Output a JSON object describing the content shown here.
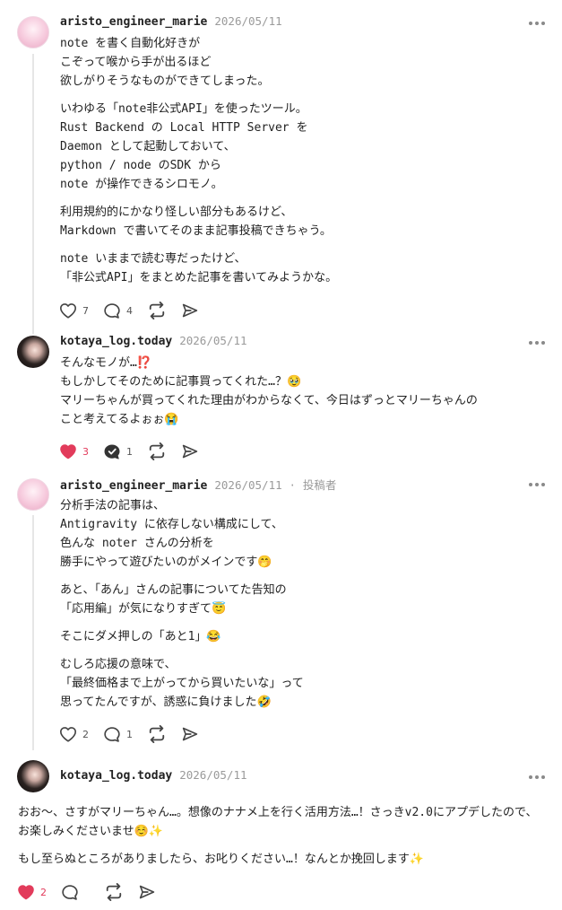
{
  "comments": [
    {
      "username": "aristo_engineer_marie",
      "date": "2026/05/11",
      "role": "",
      "paragraphs": [
        [
          "note を書く自動化好きが",
          "こぞって喉から手が出るほど",
          "欲しがりそうなものができてしまった。"
        ],
        [
          "いわゆる「note非公式API」を使ったツール。",
          "Rust Backend の Local HTTP Server を",
          "Daemon として起動しておいて、",
          "python / node のSDK から",
          "note が操作できるシロモノ。"
        ],
        [
          "利用規約的にかなり怪しい部分もあるけど、",
          "Markdown で書いてそのまま記事投稿できちゃう。"
        ],
        [
          "note いままで読む専だったけど、",
          "「非公式API」をまとめた記事を書いてみようかな。"
        ]
      ],
      "likes": "7",
      "liked": false,
      "replies": "4"
    },
    {
      "username": "kotaya_log.today",
      "date": "2026/05/11",
      "role": "",
      "paragraphs": [
        [
          "そんなモノが…⁉️",
          "もしかしてそのために記事買ってくれた…？🥹",
          "マリーちゃんが買ってくれた理由がわからなくて、今日はずっとマリーちゃんの",
          "こと考えてるよぉぉ😭"
        ]
      ],
      "likes": "3",
      "liked": true,
      "replies": "1"
    },
    {
      "username": "aristo_engineer_marie",
      "date": "2026/05/11",
      "role": "投稿者",
      "paragraphs": [
        [
          "分析手法の記事は、",
          "Antigravity に依存しない構成にして、",
          "色んな noter さんの分析を",
          "勝手にやって遊びたいのがメインです🤭"
        ],
        [
          "あと、「あん」さんの記事についてた告知の",
          "「応用編」が気になりすぎて😇"
        ],
        [
          "そこにダメ押しの「あと1」😂"
        ],
        [
          "むしろ応援の意味で、",
          "「最終価格まで上がってから買いたいな」って",
          "思ってたんですが、誘惑に負けました🤣"
        ]
      ],
      "likes": "2",
      "liked": false,
      "replies": "1"
    },
    {
      "username": "kotaya_log.today",
      "date": "2026/05/11",
      "role": "",
      "paragraphs": [
        [
          "おお〜、さすがマリーちゃん…。想像のナナメ上を行く活用方法…！さっきv2.0にアプデしたので、お楽しみくださいませ☺️✨"
        ],
        [
          "もし至らぬところがありましたら、お叱りください…！なんとか挽回します✨"
        ]
      ],
      "likes": "2",
      "liked": true,
      "replies": ""
    }
  ],
  "icons": {
    "like": "heart-icon",
    "reply": "speech-bubble-icon",
    "repost": "repost-icon",
    "share": "send-icon",
    "more": "more-dots-icon"
  },
  "colors": {
    "like_active": "#e23b5b",
    "icon": "#444444",
    "meta": "#9a9a9a",
    "thread_line": "#e6e6e6"
  }
}
